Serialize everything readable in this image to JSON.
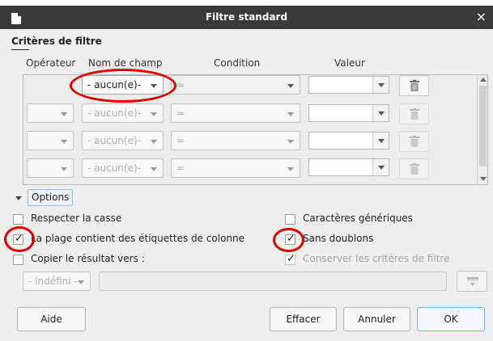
{
  "window": {
    "title": "Filtre standard",
    "close_glyph": "×"
  },
  "criteria": {
    "section_title": "Critères de filtre",
    "headers": {
      "operator": "Opérateur",
      "field_name": "Nom de champ",
      "condition": "Condition",
      "value": "Valeur"
    },
    "rows": [
      {
        "operator": "",
        "field": "- aucun(e)-",
        "condition": "=",
        "value": "",
        "enabled": true
      },
      {
        "operator": "",
        "field": "- aucun(e)-",
        "condition": "=",
        "value": "",
        "enabled": false
      },
      {
        "operator": "",
        "field": "- aucun(e)-",
        "condition": "=",
        "value": "",
        "enabled": false
      },
      {
        "operator": "",
        "field": "- aucun(e)-",
        "condition": "=",
        "value": "",
        "enabled": false
      }
    ]
  },
  "options": {
    "toggle_label": "Options",
    "expanded": true,
    "case_sensitive": {
      "label": "Respecter la casse",
      "checked": false
    },
    "range_has_headers": {
      "label": "La plage contient des étiquettes de colonne",
      "checked": true
    },
    "copy_results": {
      "label": "Copier le résultat vers :",
      "checked": false
    },
    "wildcards": {
      "label": "Caractères génériques",
      "checked": false
    },
    "no_duplicates": {
      "label": "Sans doublons",
      "checked": true
    },
    "keep_criteria": {
      "label": "Conserver les critères de filtre",
      "checked": true,
      "enabled": false
    },
    "destination": {
      "selected": "- indéfini -",
      "value": ""
    }
  },
  "buttons": {
    "help": "Aide",
    "reset": "Effacer",
    "cancel": "Annuler",
    "ok": "OK"
  },
  "icons": {
    "window": "document-icon",
    "delete": "trash-icon",
    "shrink": "shrink-dialog-icon",
    "expander": "triangle-down-icon"
  },
  "annotations": {
    "highlight_color": "#e00000"
  }
}
